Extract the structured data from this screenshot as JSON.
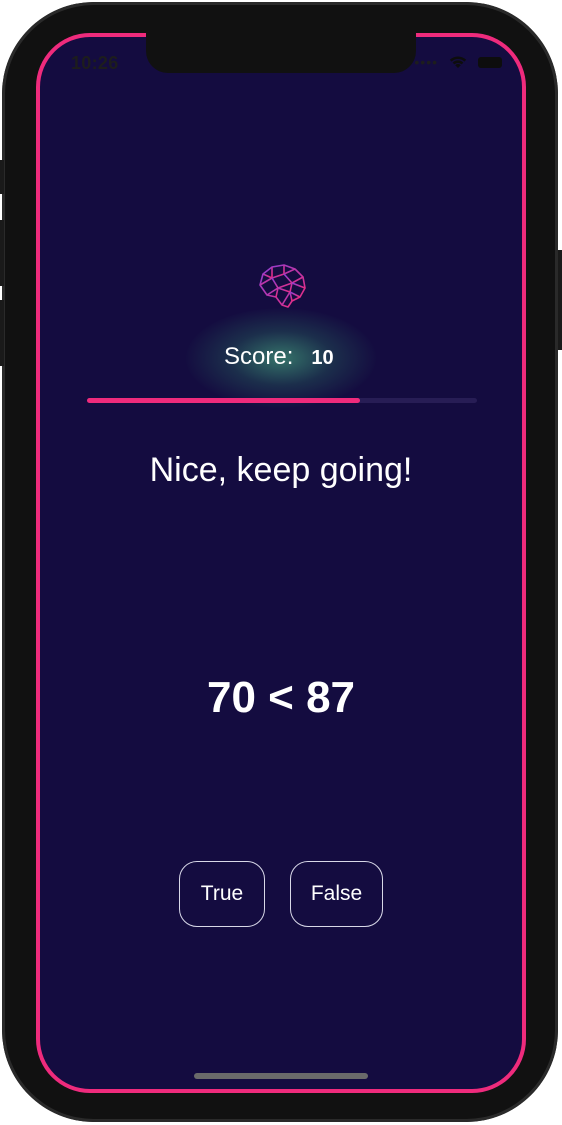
{
  "status_bar": {
    "time": "10:26",
    "signal_icon": "signal-dots-icon",
    "wifi_icon": "wifi-icon",
    "battery_icon": "battery-icon"
  },
  "app": {
    "logo_icon": "brain-icon",
    "score_label": "Score:",
    "score_value": "10",
    "progress_fraction": 0.7,
    "message": "Nice, keep going!",
    "equation": "70 < 87",
    "true_label": "True",
    "false_label": "False"
  },
  "colors": {
    "background": "#140c40",
    "accent": "#ef2b7c",
    "glow": "#50c88c",
    "text": "#ffffff"
  }
}
